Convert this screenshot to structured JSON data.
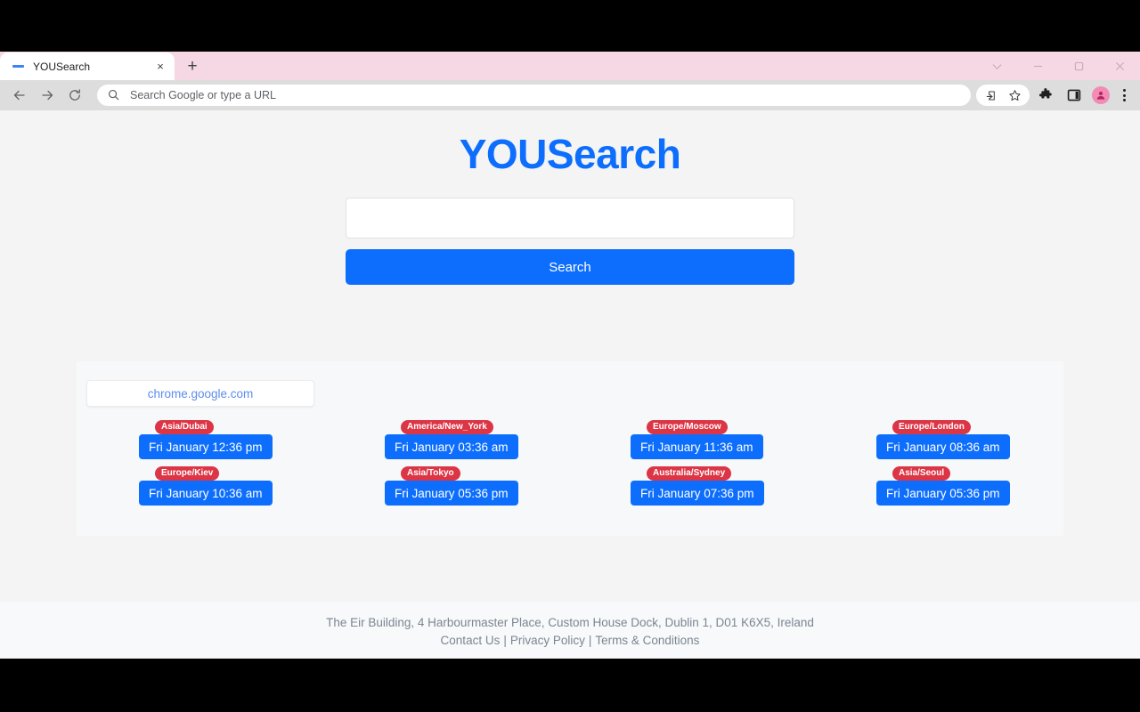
{
  "browser": {
    "tab": {
      "title": "YOUSearch",
      "favicon": "dash-icon",
      "close_label": "×"
    },
    "new_tab_label": "+",
    "window_controls": [
      {
        "name": "chevron-down-icon"
      },
      {
        "name": "minimize-icon"
      },
      {
        "name": "maximize-icon"
      },
      {
        "name": "close-icon"
      }
    ],
    "toolbar": {
      "back_icon": "back-arrow-icon",
      "forward_icon": "forward-arrow-icon",
      "reload_icon": "reload-icon",
      "omnibox_placeholder": "Search Google or type a URL",
      "omnibox_value": "",
      "share_icon": "share-icon",
      "bookmark_icon": "star-icon",
      "extensions_icon": "puzzle-icon",
      "side_panel_icon": "side-panel-icon",
      "profile_icon": "profile-avatar-icon",
      "menu_icon": "three-dots-icon"
    }
  },
  "page": {
    "brand": "YOUSearch",
    "search": {
      "value": "",
      "placeholder": "",
      "button_label": "Search"
    },
    "panel": {
      "link_label": "chrome.google.com",
      "zones": [
        {
          "badge": "Asia/Dubai",
          "time": "Fri January 12:36 pm"
        },
        {
          "badge": "America/New_York",
          "time": "Fri January 03:36 am"
        },
        {
          "badge": "Europe/Moscow",
          "time": "Fri January 11:36 am"
        },
        {
          "badge": "Europe/London",
          "time": "Fri January 08:36 am"
        },
        {
          "badge": "Europe/Kiev",
          "time": "Fri January 10:36 am"
        },
        {
          "badge": "Asia/Tokyo",
          "time": "Fri January 05:36 pm"
        },
        {
          "badge": "Australia/Sydney",
          "time": "Fri January 07:36 pm"
        },
        {
          "badge": "Asia/Seoul",
          "time": "Fri January 05:36 pm"
        }
      ]
    },
    "footer": {
      "address": "The Eir Building, 4 Harbourmaster Place, Custom House Dock, Dublin 1, D01 K6X5, Ireland",
      "links": [
        {
          "label": "Contact Us"
        },
        {
          "label": "Privacy Policy"
        },
        {
          "label": "Terms & Conditions"
        }
      ],
      "separator": "|"
    }
  },
  "colors": {
    "brand_blue": "#0d6efd",
    "badge_red": "#dc3545",
    "link_blue": "#5b8dee",
    "tabstrip_pink": "#f6d7e4",
    "page_bg": "#f4f4f4",
    "panel_bg": "#f6f8fa",
    "footer_bg": "#f7f9fb"
  }
}
